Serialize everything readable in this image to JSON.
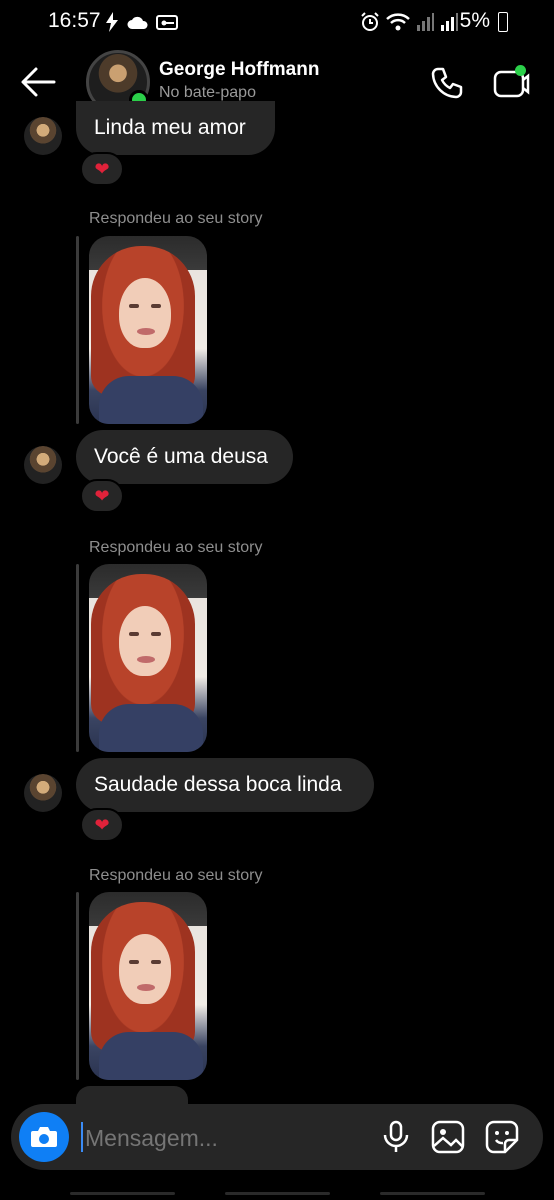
{
  "status_bar": {
    "time": "16:57",
    "battery": "5%"
  },
  "header": {
    "name": "George Hoffmann",
    "status": "No bate-papo"
  },
  "messages": [
    {
      "text": "Linda meu amor",
      "reaction": "❤"
    },
    {
      "replied_label": "Respondeu ao seu story"
    },
    {
      "text": "Você é uma deusa",
      "reaction": "❤"
    },
    {
      "replied_label": "Respondeu ao seu story"
    },
    {
      "text": "Saudade dessa boca linda",
      "reaction": "❤"
    },
    {
      "replied_label": "Respondeu ao seu story"
    }
  ],
  "composer": {
    "placeholder": "Mensagem..."
  },
  "colors": {
    "online": "#2bd04a",
    "accent": "#0f7ff5",
    "bubble": "#262626",
    "heart": "#e0223a"
  },
  "icons": [
    "back-arrow-icon",
    "phone-icon",
    "video-icon",
    "camera-icon",
    "mic-icon",
    "gallery-icon",
    "sticker-icon",
    "heart-icon"
  ]
}
